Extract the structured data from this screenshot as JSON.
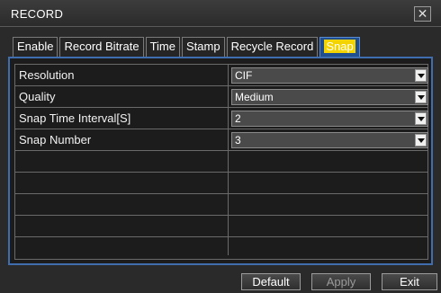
{
  "window": {
    "title": "RECORD",
    "close_icon": "close-icon"
  },
  "tabs": [
    {
      "label": "Enable"
    },
    {
      "label": "Record Bitrate"
    },
    {
      "label": "Time"
    },
    {
      "label": "Stamp"
    },
    {
      "label": "Recycle Record"
    },
    {
      "label": "Snap",
      "active": true
    }
  ],
  "settings": [
    {
      "label": "Resolution",
      "value": "CIF"
    },
    {
      "label": "Quality",
      "value": "Medium"
    },
    {
      "label": "Snap Time Interval[S]",
      "value": "2"
    },
    {
      "label": "Snap Number",
      "value": "3"
    }
  ],
  "buttons": {
    "default": "Default",
    "apply": "Apply",
    "exit": "Exit"
  },
  "colors": {
    "active_tab": "#1f4f8e",
    "highlight": "#f4d400",
    "panel_border": "#3f6dae"
  }
}
